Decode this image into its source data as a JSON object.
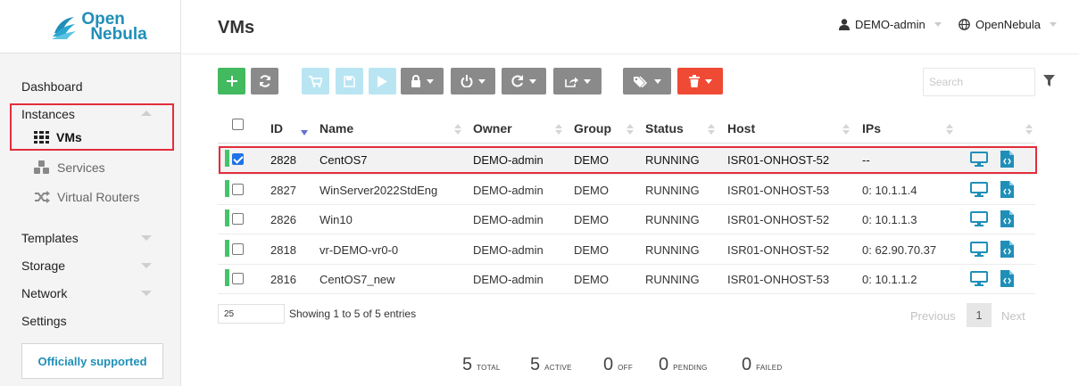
{
  "brand": {
    "line1": "Open",
    "line2": "Nebula"
  },
  "sidebar": {
    "dashboard": "Dashboard",
    "instances": "Instances",
    "vms": "VMs",
    "services": "Services",
    "virtual_routers": "Virtual Routers",
    "templates": "Templates",
    "storage": "Storage",
    "network": "Network",
    "settings": "Settings",
    "support": "Officially supported"
  },
  "header": {
    "title": "VMs",
    "user": "DEMO-admin",
    "zone": "OpenNebula"
  },
  "search": {
    "placeholder": "Search"
  },
  "table": {
    "columns": [
      "ID",
      "Name",
      "Owner",
      "Group",
      "Status",
      "Host",
      "IPs"
    ],
    "rows": [
      {
        "id": "2828",
        "name": "CentOS7",
        "owner": "DEMO-admin",
        "group": "DEMO",
        "status": "RUNNING",
        "host": "ISR01-ONHOST-52",
        "ips": "--",
        "selected": true
      },
      {
        "id": "2827",
        "name": "WinServer2022StdEng",
        "owner": "DEMO-admin",
        "group": "DEMO",
        "status": "RUNNING",
        "host": "ISR01-ONHOST-53",
        "ips": "0: 10.1.1.4",
        "selected": false
      },
      {
        "id": "2826",
        "name": "Win10",
        "owner": "DEMO-admin",
        "group": "DEMO",
        "status": "RUNNING",
        "host": "ISR01-ONHOST-52",
        "ips": "0: 10.1.1.3",
        "selected": false
      },
      {
        "id": "2818",
        "name": "vr-DEMO-vr0-0",
        "owner": "DEMO-admin",
        "group": "DEMO",
        "status": "RUNNING",
        "host": "ISR01-ONHOST-52",
        "ips": "0: 62.90.70.37",
        "selected": false
      },
      {
        "id": "2816",
        "name": "CentOS7_new",
        "owner": "DEMO-admin",
        "group": "DEMO",
        "status": "RUNNING",
        "host": "ISR01-ONHOST-53",
        "ips": "0: 10.1.1.2",
        "selected": false
      }
    ]
  },
  "footer": {
    "page_size": "25",
    "showing": "Showing 1 to 5 of 5 entries",
    "previous": "Previous",
    "current_page": "1",
    "next": "Next"
  },
  "summary": {
    "total": {
      "num": "5",
      "label": "TOTAL"
    },
    "active": {
      "num": "5",
      "label": "ACTIVE"
    },
    "off": {
      "num": "0",
      "label": "OFF"
    },
    "pending": {
      "num": "0",
      "label": "PENDING"
    },
    "failed": {
      "num": "0",
      "label": "FAILED"
    }
  },
  "colors": {
    "green": "#43b960",
    "grey": "#8a8a8a",
    "red": "#ef4a34",
    "brand": "#1f8fb8",
    "highlight": "#e32d3b",
    "state_running": "#44c36a"
  }
}
